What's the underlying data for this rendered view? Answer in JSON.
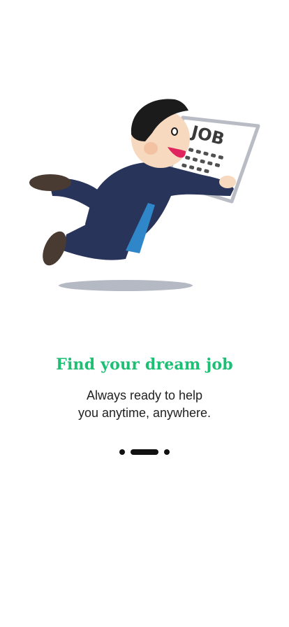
{
  "onboarding": {
    "illustration_icon": "job-seeker-illustration",
    "sign_text": "JOB",
    "title": "Find your dream job",
    "subtitle_line1": "Always ready to help",
    "subtitle_line2": "you anytime, anywhere.",
    "page_count": 3,
    "current_page": 2
  },
  "colors": {
    "accent": "#1cbf73",
    "text": "#1f1f1f",
    "dot": "#111111"
  }
}
